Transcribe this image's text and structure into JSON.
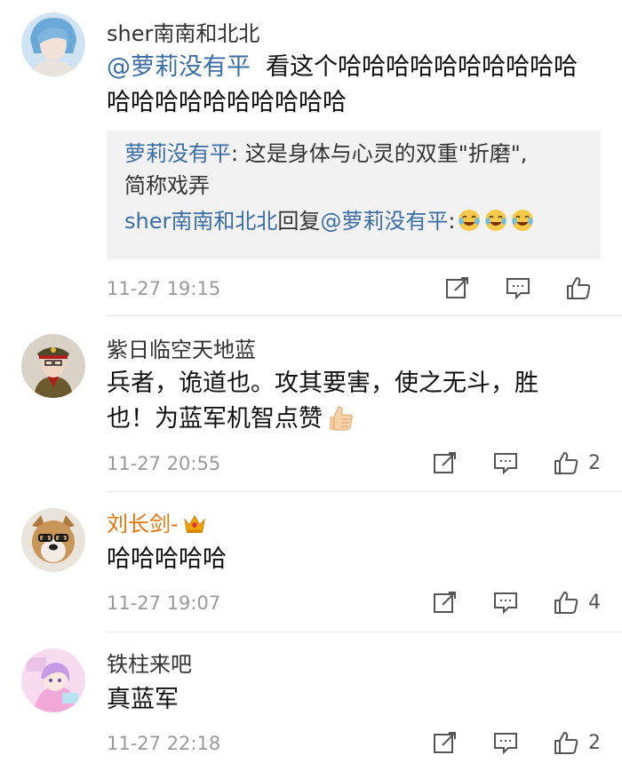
{
  "comments": [
    {
      "username": "sher南南和北北",
      "mention": "@萝莉没有平",
      "text": "看这个哈哈哈哈哈哈哈哈哈哈哈哈哈哈哈哈哈哈哈哈",
      "quote": {
        "author": "萝莉没有平",
        "text_line1": "这是身体与心灵的双重\"折磨\",",
        "text_line2": "简称戏弄",
        "reply_user": "sher南南和北北",
        "reply_word": "回复",
        "reply_target": "@萝莉没有平"
      },
      "time": "11-27 19:15",
      "likes": ""
    },
    {
      "username": "紫日临空天地蓝",
      "text_line1": "兵者，诡道也。攻其要害，使之无斗，胜",
      "text_line2": "也！为蓝军机智点赞",
      "time": "11-27 20:55",
      "likes": "2"
    },
    {
      "username": "刘长剑-",
      "text": "哈哈哈哈哈",
      "time": "11-27 19:07",
      "likes": "4"
    },
    {
      "username": "铁柱来吧",
      "text": "真蓝军",
      "time": "11-27 22:18",
      "likes": "2"
    }
  ],
  "icons": {
    "repost": "repost-icon",
    "comment": "comment-icon",
    "like": "thumbs-up-icon"
  },
  "colors": {
    "link": "#3a6ea5",
    "vip_name": "#e8750a",
    "meta": "#9a9a9a",
    "quote_bg": "#f2f2f2"
  }
}
